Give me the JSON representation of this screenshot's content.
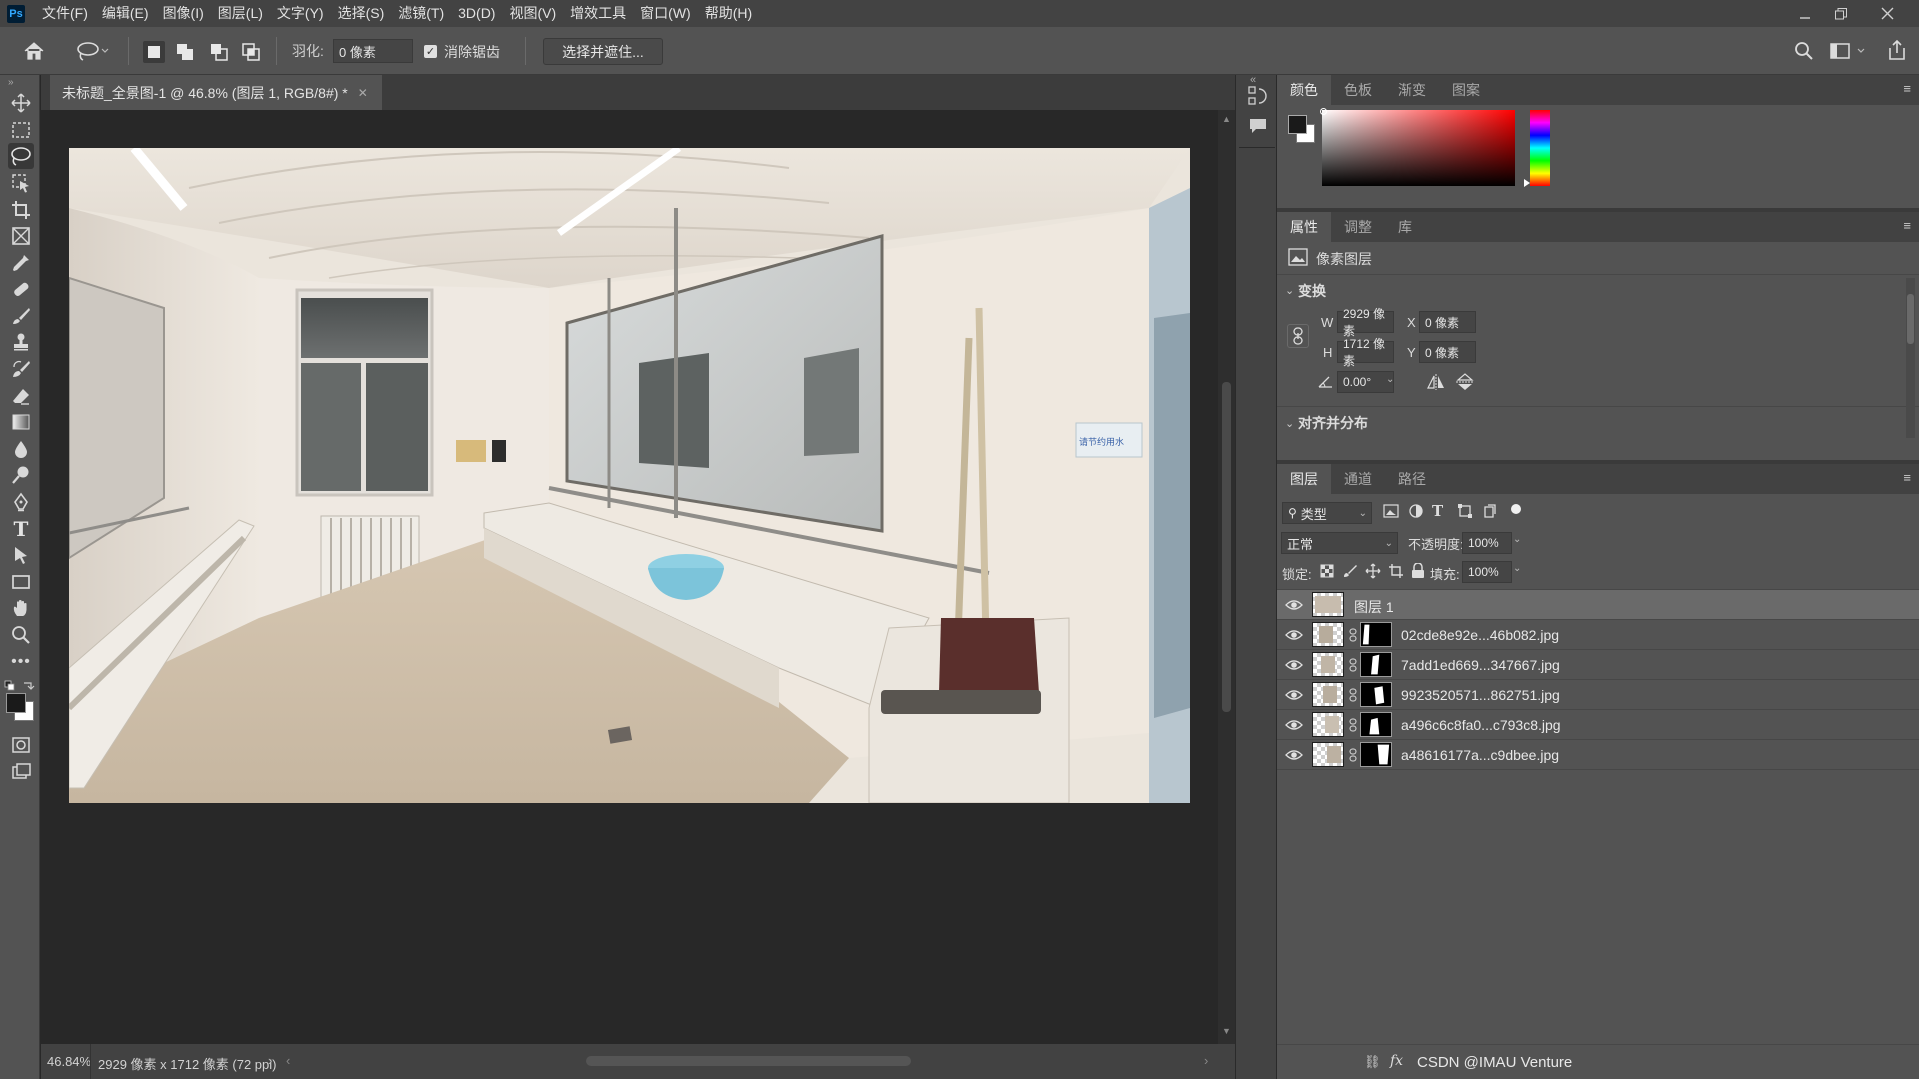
{
  "app": {
    "logo": "Ps",
    "menu": [
      "文件(F)",
      "编辑(E)",
      "图像(I)",
      "图层(L)",
      "文字(Y)",
      "选择(S)",
      "滤镜(T)",
      "3D(D)",
      "视图(V)",
      "增效工具",
      "窗口(W)",
      "帮助(H)"
    ]
  },
  "options": {
    "feather_label": "羽化:",
    "feather_value": "0 像素",
    "antialias_label": "消除锯齿",
    "antialias_checked": true,
    "select_mask_button": "选择并遮住..."
  },
  "document": {
    "tab_title": "未标题_全景图-1 @ 46.8% (图层 1, RGB/8#) *",
    "zoom": "46.84%",
    "dimensions": "2929 像素 x 1712 像素 (72 ppi)"
  },
  "color_panel": {
    "tabs": [
      "颜色",
      "色板",
      "渐变",
      "图案"
    ],
    "active_tab": "颜色",
    "foreground": "#1a1a1a",
    "background": "#ffffff"
  },
  "properties_panel": {
    "tabs": [
      "属性",
      "调整",
      "库"
    ],
    "active_tab": "属性",
    "layer_type": "像素图层",
    "transform_label": "变换",
    "w_label": "W",
    "w_value": "2929 像素",
    "h_label": "H",
    "h_value": "1712 像素",
    "x_label": "X",
    "x_value": "0 像素",
    "y_label": "Y",
    "y_value": "0 像素",
    "angle_value": "0.00°",
    "align_label": "对齐并分布"
  },
  "layers_panel": {
    "tabs": [
      "图层",
      "通道",
      "路径"
    ],
    "active_tab": "图层",
    "filter_kind": "类型",
    "blend_mode": "正常",
    "opacity_label": "不透明度:",
    "opacity_value": "100%",
    "lock_label": "锁定:",
    "fill_label": "填充:",
    "fill_value": "100%",
    "layers": [
      {
        "name": "图层 1",
        "selected": true,
        "has_mask": false
      },
      {
        "name": "02cde8e92e...46b082.jpg",
        "selected": false,
        "has_mask": true
      },
      {
        "name": "7add1ed669...347667.jpg",
        "selected": false,
        "has_mask": true
      },
      {
        "name": "9923520571...862751.jpg",
        "selected": false,
        "has_mask": true
      },
      {
        "name": "a496c6c8fa0...c793c8.jpg",
        "selected": false,
        "has_mask": true
      },
      {
        "name": "a48616177a...c9dbee.jpg",
        "selected": false,
        "has_mask": true
      }
    ],
    "footer_text": "CSDN @IMAU Venture"
  }
}
